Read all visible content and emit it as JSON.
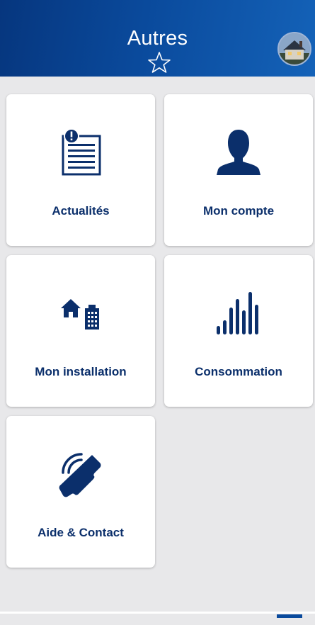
{
  "header": {
    "title": "Autres",
    "favorite_icon": "star-outline-icon",
    "avatar": "house-photo-avatar"
  },
  "tiles": [
    {
      "label": "Actualités",
      "icon": "news-document-icon"
    },
    {
      "label": "Mon compte",
      "icon": "user-silhouette-icon"
    },
    {
      "label": "Mon installation",
      "icon": "house-building-icon"
    },
    {
      "label": "Consommation",
      "icon": "consumption-bars-icon"
    },
    {
      "label": "Aide & Contact",
      "icon": "phone-ringing-icon"
    }
  ],
  "colors": {
    "header_dark": "#06367e",
    "header_light": "#1462b8",
    "icon": "#0b2f6b",
    "background": "#e8e8ea",
    "tile": "#ffffff"
  }
}
